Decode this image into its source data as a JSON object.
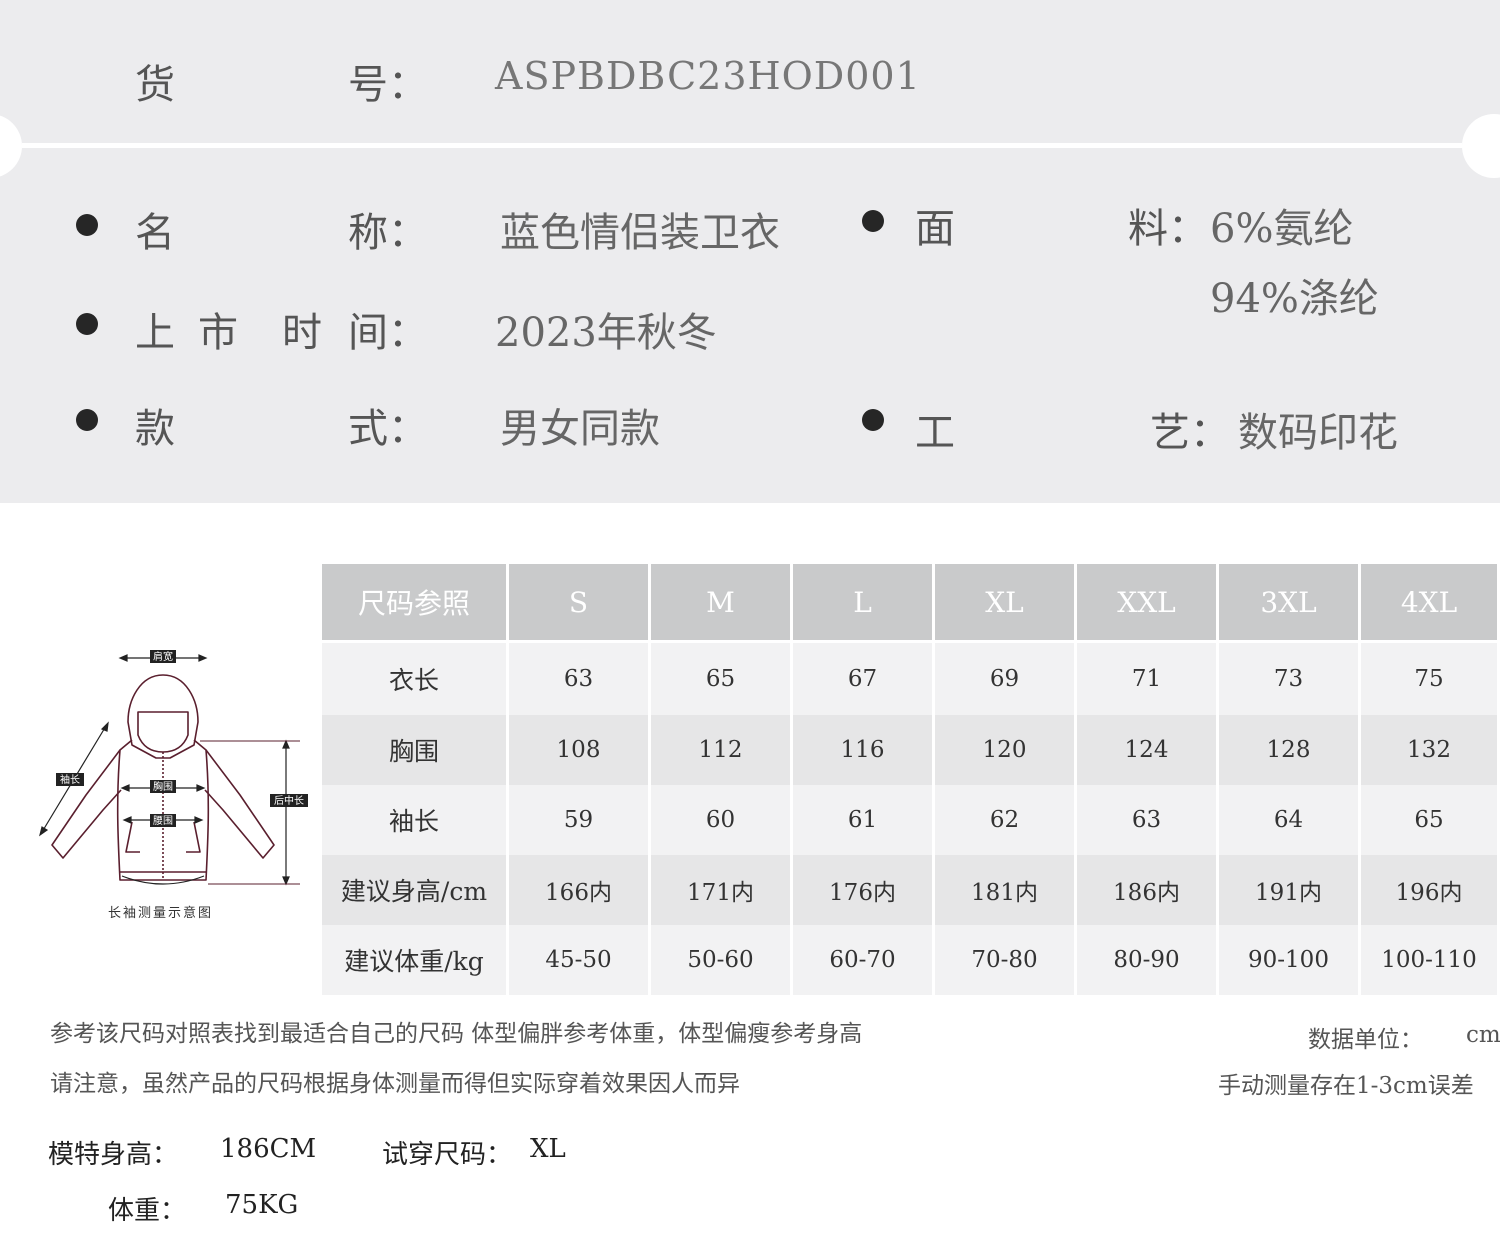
{
  "header": {
    "code_label_1": "货",
    "code_label_2": "号：",
    "code_value": "ASPBDBC23HOD001"
  },
  "info": {
    "name_label_1": "名",
    "name_label_2": "称：",
    "name_value": "蓝色情侣装卫衣",
    "launch_label_1": "上",
    "launch_label_2": "市",
    "launch_label_3": "时",
    "launch_label_4": "间：",
    "launch_value": "2023年秋冬",
    "style_label_1": "款",
    "style_label_2": "式：",
    "style_value": "男女同款",
    "fabric_label_1": "面",
    "fabric_label_2": "料：",
    "fabric_value_1": "6%氨纶",
    "fabric_value_2": "94%涤纶",
    "craft_label_1": "工",
    "craft_label_2": "艺：",
    "craft_value": "数码印花"
  },
  "diagram": {
    "shoulder": "肩宽",
    "sleeve": "袖长",
    "chest": "胸围",
    "waist": "腰围",
    "back_length": "后中长",
    "caption": "长袖测量示意图"
  },
  "size_table": {
    "header_label": "尺码参照",
    "sizes": [
      "S",
      "M",
      "L",
      "XL",
      "XXL",
      "3XL",
      "4XL"
    ],
    "rows": [
      {
        "label": "衣长",
        "values": [
          "63",
          "65",
          "67",
          "69",
          "71",
          "73",
          "75"
        ]
      },
      {
        "label": "胸围",
        "values": [
          "108",
          "112",
          "116",
          "120",
          "124",
          "128",
          "132"
        ]
      },
      {
        "label": "袖长",
        "values": [
          "59",
          "60",
          "61",
          "62",
          "63",
          "64",
          "65"
        ]
      },
      {
        "label": "建议身高/cm",
        "values": [
          "166内",
          "171内",
          "176内",
          "181内",
          "186内",
          "191内",
          "196内"
        ]
      },
      {
        "label": "建议体重/kg",
        "values": [
          "45-50",
          "50-60",
          "60-70",
          "70-80",
          "80-90",
          "90-100",
          "100-110"
        ]
      }
    ]
  },
  "notes": {
    "line1": "参考该尺码对照表找到最适合自己的尺码  体型偏胖参考体重，体型偏瘦参考身高",
    "line2": "请注意，虽然产品的尺码根据身体测量而得但实际穿着效果因人而异",
    "unit_label": "数据单位：",
    "unit_value": "cm",
    "error_note": "手动测量存在1-3cm误差"
  },
  "model": {
    "height_label": "模特身高：",
    "height_value": "186CM",
    "size_label": "试穿尺码：",
    "size_value": "XL",
    "weight_label": "体重：",
    "weight_value": "75KG"
  }
}
